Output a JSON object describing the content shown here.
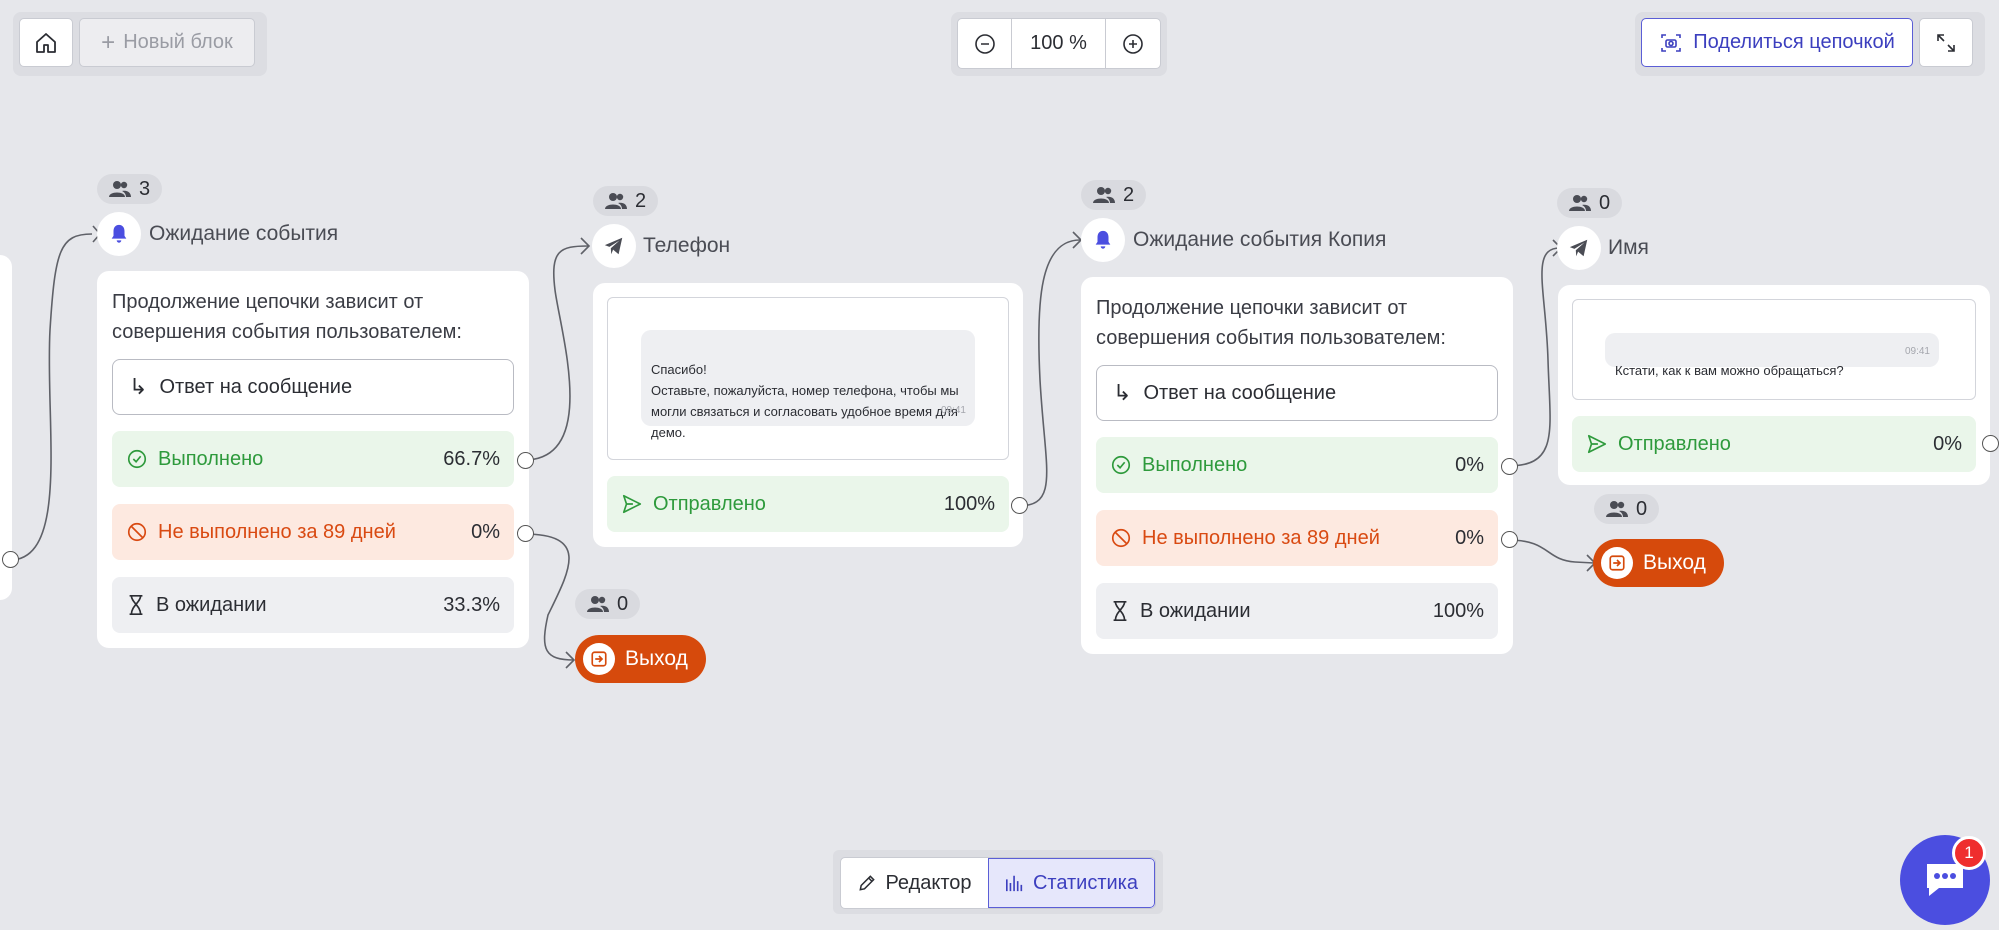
{
  "toolbar": {
    "new_block_label": "Новый блок",
    "zoom_value": "100 %",
    "share_label": "Поделиться цепочкой"
  },
  "nodes": {
    "wait1": {
      "count": "3",
      "title": "Ожидание события",
      "condition_text": "Продолжение цепочки зависит от совершения события пользователем:",
      "event_label": "Ответ на сообщение",
      "done_label": "Выполнено",
      "done_value": "66.7%",
      "fail_label": "Не выполнено за 89 дней",
      "fail_value": "0%",
      "wait_label": "В ожидании",
      "wait_value": "33.3%"
    },
    "phone": {
      "count": "2",
      "title": "Телефон",
      "message": "Спасибо!\nОставьте, пожалуйста, номер телефона, чтобы мы могли связаться и согласовать удобное время для демо.",
      "time": "09:41",
      "sent_label": "Отправлено",
      "sent_value": "100%"
    },
    "exit1": {
      "count": "0",
      "label": "Выход"
    },
    "wait2": {
      "count": "2",
      "title": "Ожидание события Копия",
      "condition_text": "Продолжение цепочки зависит от совершения события пользователем:",
      "event_label": "Ответ на сообщение",
      "done_label": "Выполнено",
      "done_value": "0%",
      "fail_label": "Не выполнено за 89 дней",
      "fail_value": "0%",
      "wait_label": "В ожидании",
      "wait_value": "100%"
    },
    "name": {
      "count": "0",
      "title": "Имя",
      "message": "Кстати, как к вам можно обращаться?",
      "time": "09:41",
      "sent_label": "Отправлено",
      "sent_value": "0%"
    },
    "exit2": {
      "count": "0",
      "label": "Выход"
    }
  },
  "mode_switch": {
    "editor_label": "Редактор",
    "stats_label": "Статистика"
  },
  "chat_widget": {
    "badge": "1"
  },
  "colors": {
    "accent": "#4b4ee0",
    "success": "#2e9a3c",
    "danger": "#d64a0c",
    "canvas": "#e6e7eb"
  }
}
